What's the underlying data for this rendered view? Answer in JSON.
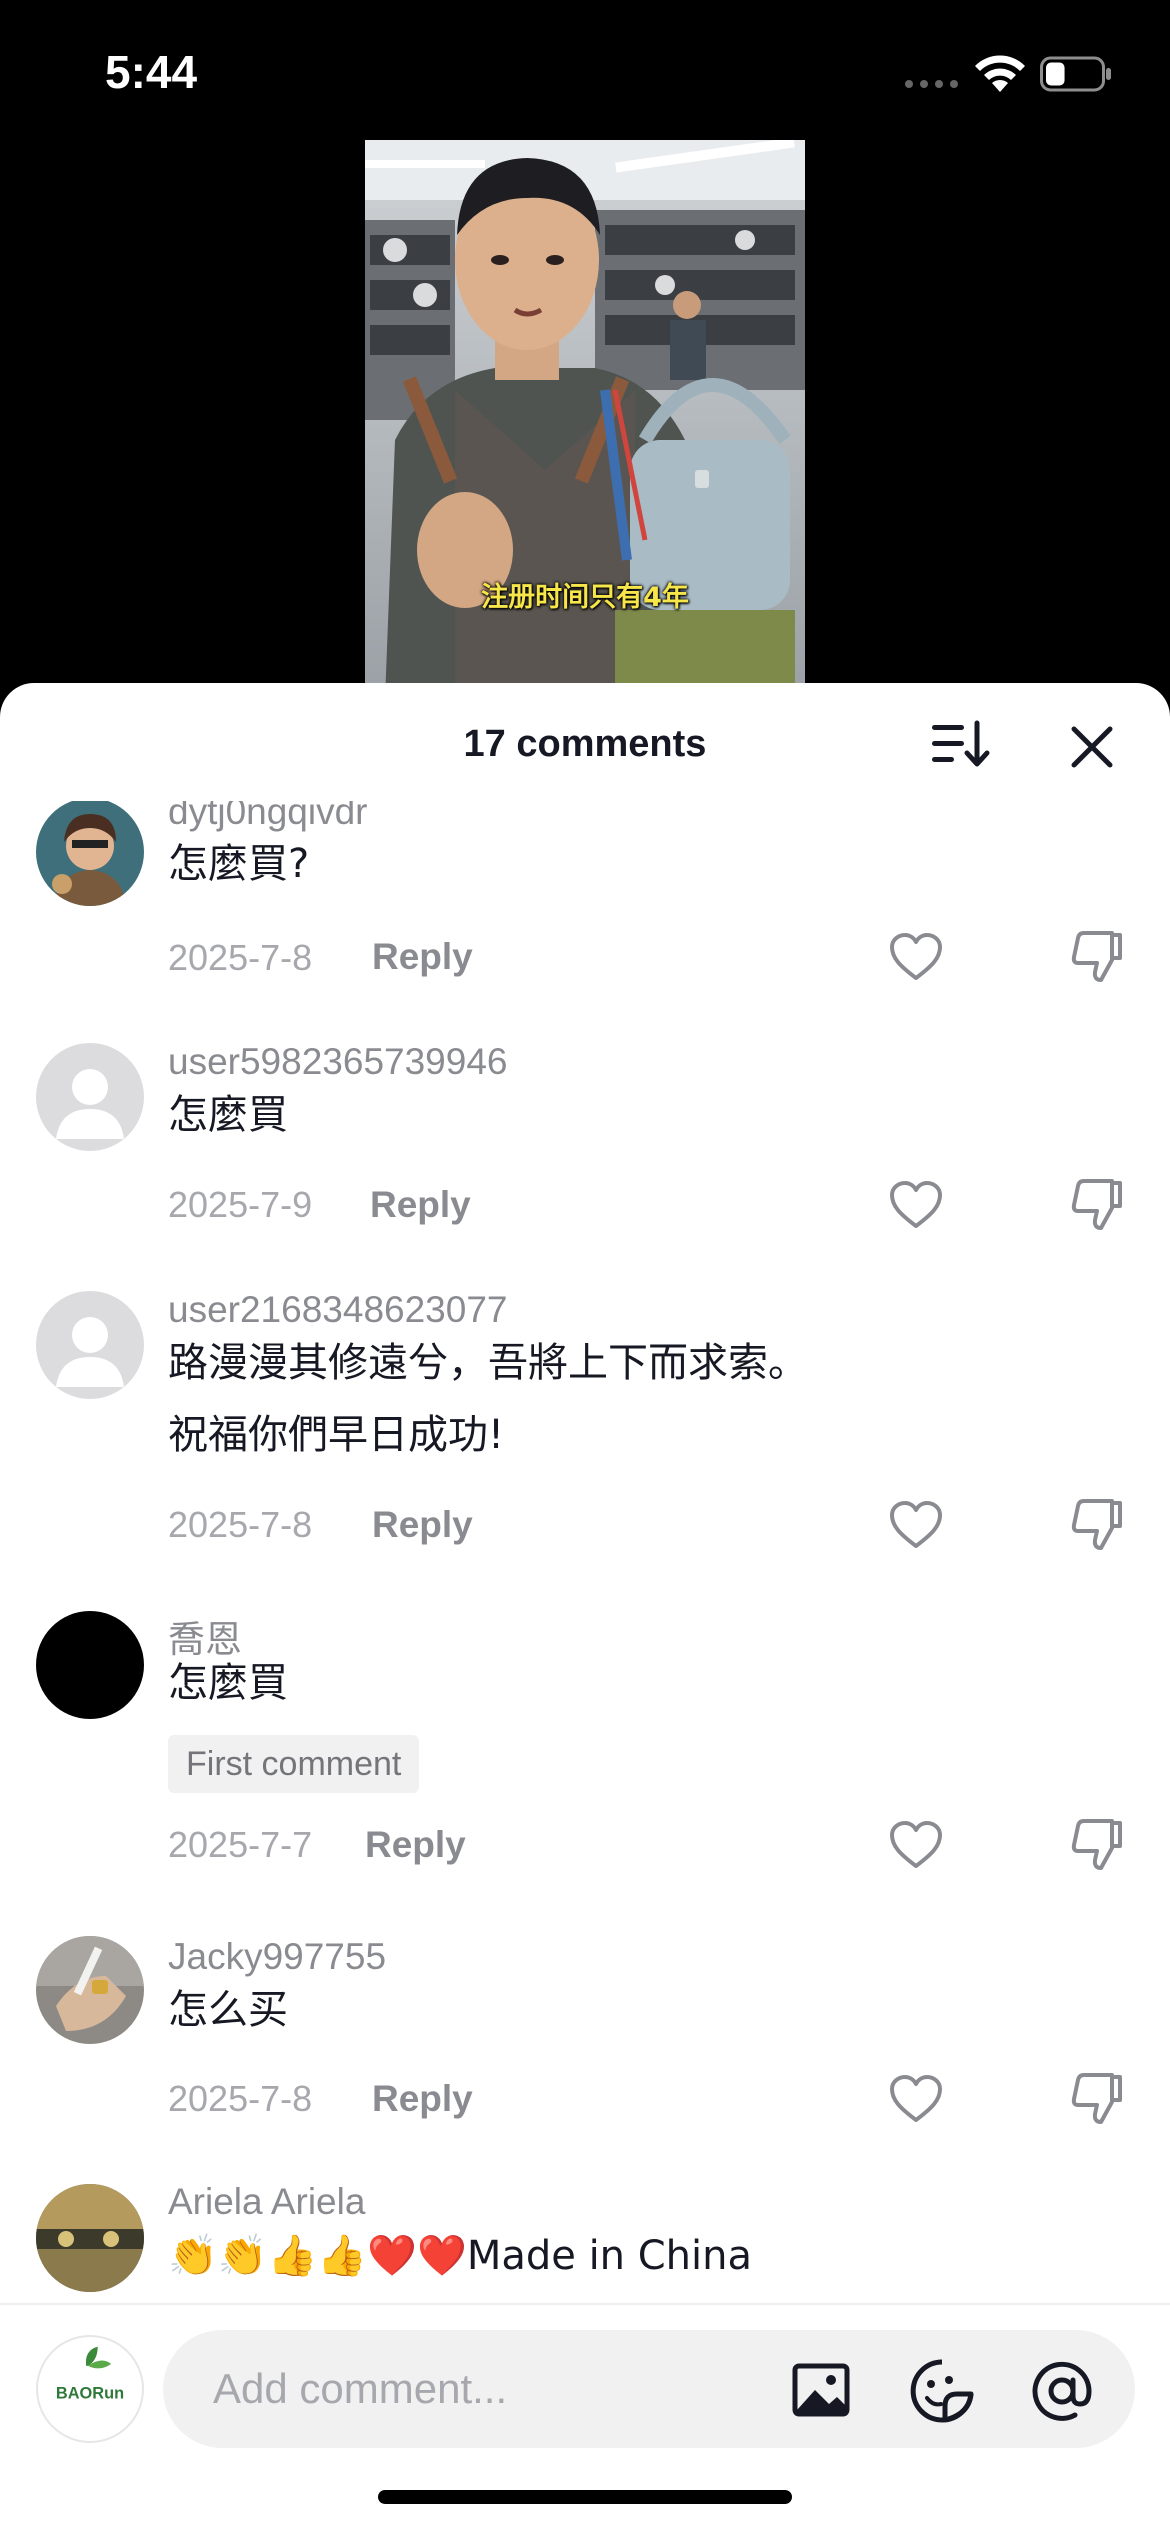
{
  "status_bar": {
    "time": "5:44",
    "battery_level": 0.35
  },
  "video": {
    "caption": "注册时间只有4年"
  },
  "comments_sheet": {
    "title": "17 comments",
    "comments": [
      {
        "username": "dytj0ngqivdr",
        "lines": [
          "怎麼買?"
        ],
        "date": "2025-7-8",
        "reply_label": "Reply",
        "avatar": "cartoon-avatar"
      },
      {
        "username": "user5982365739946",
        "lines": [
          "怎麼買"
        ],
        "date": "2025-7-9",
        "reply_label": "Reply",
        "avatar": "default-avatar"
      },
      {
        "username": "user2168348623077",
        "lines": [
          "路漫漫其修遠兮，吾將上下而求索。",
          "祝福你們早日成功!"
        ],
        "date": "2025-7-8",
        "reply_label": "Reply",
        "avatar": "default-avatar"
      },
      {
        "username": "喬恩",
        "lines": [
          "怎麼買"
        ],
        "badge": "First comment",
        "date": "2025-7-7",
        "reply_label": "Reply",
        "avatar": "black-avatar"
      },
      {
        "username": "Jacky997755",
        "lines": [
          "怎么买"
        ],
        "date": "2025-7-8",
        "reply_label": "Reply",
        "avatar": "ring-photo-avatar"
      },
      {
        "username": "Ariela Ariela",
        "lines": [
          "👏👏👍👍❤️❤️Made in China"
        ],
        "avatar": "landscape-avatar"
      }
    ]
  },
  "composer": {
    "placeholder": "Add comment...",
    "avatar_text": "BAORun"
  }
}
